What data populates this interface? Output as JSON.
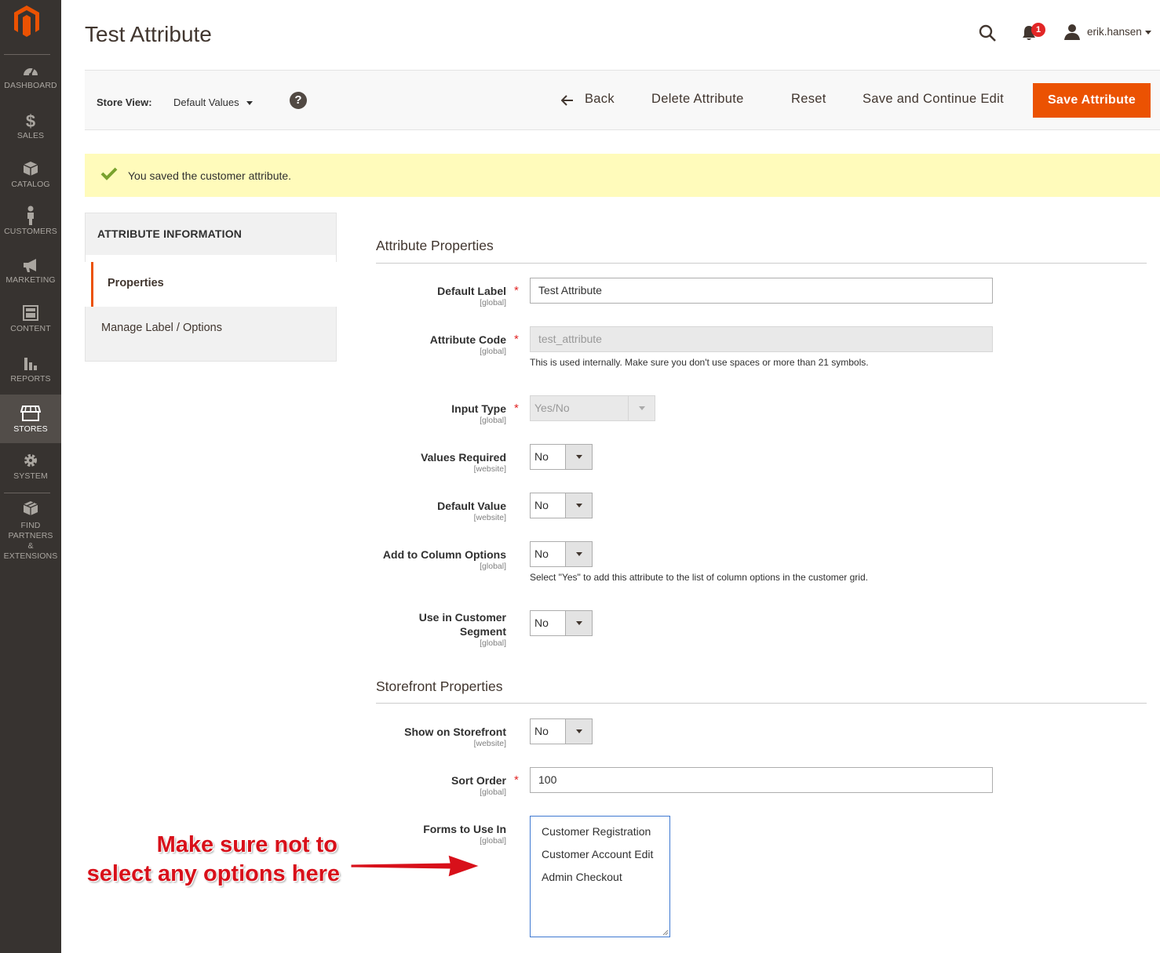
{
  "colors": {
    "nav_bg": "#373330",
    "nav_active": "#524d49",
    "accent": "#eb5202",
    "success": "#79a22e",
    "message_bg": "#fffbbb",
    "required": "#e22626",
    "annotation": "#d8101a"
  },
  "nav": {
    "items": [
      {
        "label": "DASHBOARD",
        "icon": "dashboard-icon"
      },
      {
        "label": "SALES",
        "icon": "dollar-icon"
      },
      {
        "label": "CATALOG",
        "icon": "box-icon"
      },
      {
        "label": "CUSTOMERS",
        "icon": "person-icon"
      },
      {
        "label": "MARKETING",
        "icon": "megaphone-icon"
      },
      {
        "label": "CONTENT",
        "icon": "layout-icon"
      },
      {
        "label": "REPORTS",
        "icon": "bar-chart-icon"
      },
      {
        "label": "STORES",
        "icon": "storefront-icon",
        "active": true
      },
      {
        "label": "SYSTEM",
        "icon": "gear-icon"
      },
      {
        "label": "FIND PARTNERS\n& EXTENSIONS",
        "icon": "boxes-icon"
      }
    ]
  },
  "header": {
    "title": "Test Attribute",
    "notifications_count": "1",
    "username": "erik.hansen"
  },
  "action_bar": {
    "store_view_label": "Store View:",
    "store_view_value": "Default Values",
    "help": "?",
    "back": "Back",
    "delete": "Delete Attribute",
    "reset": "Reset",
    "save_continue": "Save and Continue Edit",
    "save": "Save Attribute"
  },
  "message": {
    "text": "You saved the customer attribute."
  },
  "tabs": {
    "title": "ATTRIBUTE INFORMATION",
    "items": [
      "Properties",
      "Manage Label / Options"
    ]
  },
  "attribute_properties": {
    "title": "Attribute Properties",
    "default_label": {
      "label": "Default Label",
      "scope": "[global]",
      "value": "Test Attribute"
    },
    "attribute_code": {
      "label": "Attribute Code",
      "scope": "[global]",
      "value": "test_attribute",
      "note": "This is used internally. Make sure you don't use spaces or more than 21 symbols."
    },
    "input_type": {
      "label": "Input Type",
      "scope": "[global]",
      "value": "Yes/No"
    },
    "values_required": {
      "label": "Values Required",
      "scope": "[website]",
      "value": "No"
    },
    "default_value": {
      "label": "Default Value",
      "scope": "[website]",
      "value": "No"
    },
    "add_to_column": {
      "label": "Add to Column Options",
      "scope": "[global]",
      "value": "No",
      "note": "Select \"Yes\" to add this attribute to the list of column options in the customer grid."
    },
    "customer_segment": {
      "label_line1": "Use in Customer",
      "label_line2": "Segment",
      "scope": "[global]",
      "value": "No"
    }
  },
  "storefront_properties": {
    "title": "Storefront Properties",
    "show_on_storefront": {
      "label": "Show on Storefront",
      "scope": "[website]",
      "value": "No"
    },
    "sort_order": {
      "label": "Sort Order",
      "scope": "[global]",
      "value": "100"
    },
    "forms": {
      "label": "Forms to Use In",
      "scope": "[global]",
      "options": [
        "Customer Registration",
        "Customer Account Edit",
        "Admin Checkout"
      ]
    }
  },
  "required_mark": "*",
  "annotation": {
    "line1": "Make sure not to",
    "line2": "select any options here"
  }
}
